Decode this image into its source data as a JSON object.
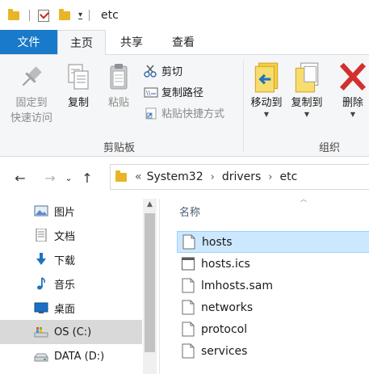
{
  "window": {
    "title": "etc"
  },
  "tabs": [
    {
      "label": "文件"
    },
    {
      "label": "主页"
    },
    {
      "label": "共享"
    },
    {
      "label": "查看"
    }
  ],
  "ribbon": {
    "clipboard": {
      "group_label": "剪贴板",
      "pin_label_line1": "固定到",
      "pin_label_line2": "快速访问",
      "copy_label": "复制",
      "paste_label": "粘贴",
      "cut_label": "剪切",
      "copy_path_label": "复制路径",
      "paste_shortcut_label": "粘贴快捷方式"
    },
    "organize": {
      "group_label": "组织",
      "move_to_label": "移动到",
      "copy_to_label": "复制到",
      "delete_label": "删除"
    }
  },
  "address": {
    "overflow": "«",
    "crumbs": [
      "System32",
      "drivers",
      "etc"
    ]
  },
  "nav": {
    "items": [
      {
        "label": "图片",
        "icon": "pictures-icon"
      },
      {
        "label": "文档",
        "icon": "documents-icon"
      },
      {
        "label": "下载",
        "icon": "downloads-icon"
      },
      {
        "label": "音乐",
        "icon": "music-icon"
      },
      {
        "label": "桌面",
        "icon": "desktop-icon"
      },
      {
        "label": "OS (C:)",
        "icon": "drive-os-icon"
      },
      {
        "label": "DATA (D:)",
        "icon": "drive-icon"
      }
    ]
  },
  "files": {
    "column_name": "名称",
    "items": [
      {
        "name": "hosts"
      },
      {
        "name": "hosts.ics"
      },
      {
        "name": "lmhosts.sam"
      },
      {
        "name": "networks"
      },
      {
        "name": "protocol"
      },
      {
        "name": "services"
      }
    ]
  },
  "colors": {
    "file_tab": "#1979ca",
    "selection": "#cce8ff",
    "delete_red": "#d32f2f",
    "folder_yellow": "#e8b526"
  }
}
